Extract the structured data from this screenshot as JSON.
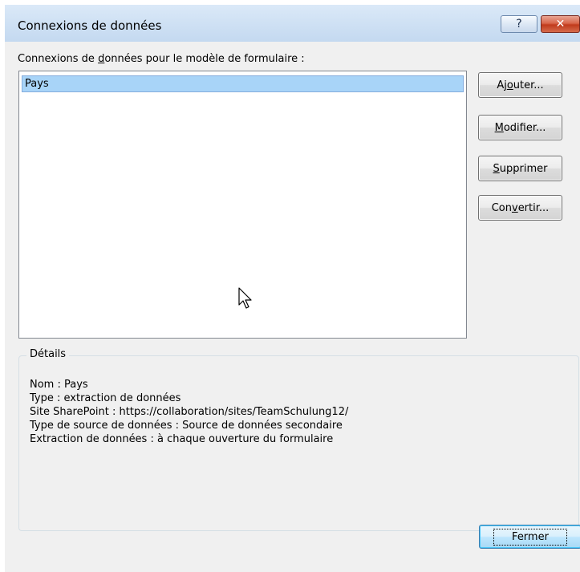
{
  "window": {
    "title": "Connexions de données",
    "help_glyph": "?",
    "close_glyph": "✕"
  },
  "connections": {
    "label_pre": "Connexions de ",
    "label_mnemonic": "d",
    "label_post": "onnées pour le modèle de formulaire :",
    "items": [
      {
        "label": "Pays",
        "selected": true
      }
    ]
  },
  "buttons": {
    "add": {
      "pre": "Aj",
      "mnemonic": "o",
      "post": "uter..."
    },
    "modify": {
      "pre": "",
      "mnemonic": "M",
      "post": "odifier..."
    },
    "delete": {
      "pre": "",
      "mnemonic": "S",
      "post": "upprimer"
    },
    "convert": {
      "pre": "Con",
      "mnemonic": "v",
      "post": "ertir..."
    },
    "close_label": "Fermer"
  },
  "details": {
    "title": "Détails",
    "lines": [
      "Nom : Pays",
      "Type : extraction de données",
      "Site SharePoint : https://collaboration/sites/TeamSchulung12/",
      "Type de source de données : Source de données secondaire",
      "Extraction de données : à chaque ouverture du formulaire"
    ]
  },
  "colors": {
    "selection": "#a8d4f8",
    "dialog_bg": "#f0f0f0",
    "close_button": "#c13b1c"
  }
}
